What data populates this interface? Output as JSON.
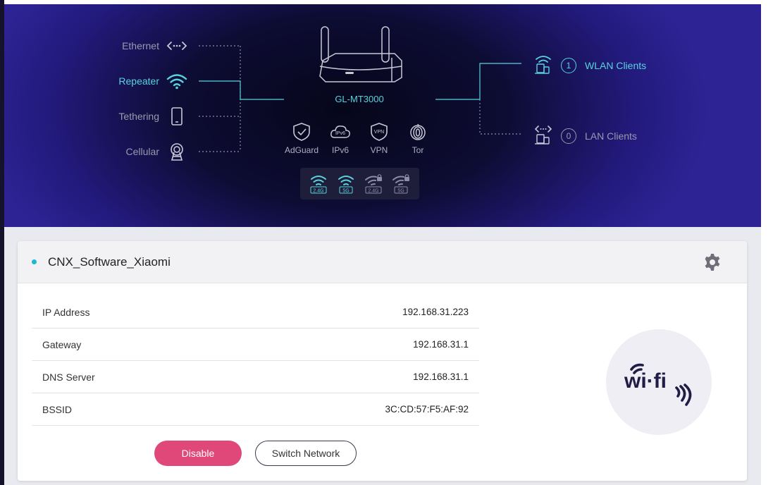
{
  "hero": {
    "wan": [
      {
        "label": "Ethernet",
        "icon": "ethernet-icon",
        "active": false
      },
      {
        "label": "Repeater",
        "icon": "wifi-icon",
        "active": true
      },
      {
        "label": "Tethering",
        "icon": "phone-icon",
        "active": false
      },
      {
        "label": "Cellular",
        "icon": "cellular-icon",
        "active": false
      }
    ],
    "device_name": "GL-MT3000",
    "services": [
      {
        "label": "AdGuard",
        "icon": "adguard-shield-icon"
      },
      {
        "label": "IPv6",
        "icon": "ipv6-cloud-icon"
      },
      {
        "label": "VPN",
        "icon": "vpn-shield-icon"
      },
      {
        "label": "Tor",
        "icon": "tor-onion-icon"
      }
    ],
    "bands": [
      {
        "label": "2.4G",
        "enabled": true
      },
      {
        "label": "5G",
        "enabled": true
      },
      {
        "label": "2.4G",
        "enabled": false
      },
      {
        "label": "5G",
        "enabled": false
      }
    ],
    "clients": {
      "wlan": {
        "count": "1",
        "label": "WLAN Clients"
      },
      "lan": {
        "count": "0",
        "label": "LAN Clients"
      }
    },
    "colors": {
      "accent": "#58d3de",
      "inactive": "#9a99ad"
    }
  },
  "card": {
    "ssid": "CNX_Software_Xiaomi",
    "rows": [
      {
        "label": "IP Address",
        "value": "192.168.31.223"
      },
      {
        "label": "Gateway",
        "value": "192.168.31.1"
      },
      {
        "label": "DNS Server",
        "value": "192.168.31.1"
      },
      {
        "label": "BSSID",
        "value": "3C:CD:57:F5:AF:92"
      }
    ],
    "buttons": {
      "disable": "Disable",
      "switch": "Switch Network"
    },
    "logo_text": "wi·fi",
    "colors": {
      "disable": "#e0487a",
      "status_dot": "#1fb8d0"
    }
  }
}
